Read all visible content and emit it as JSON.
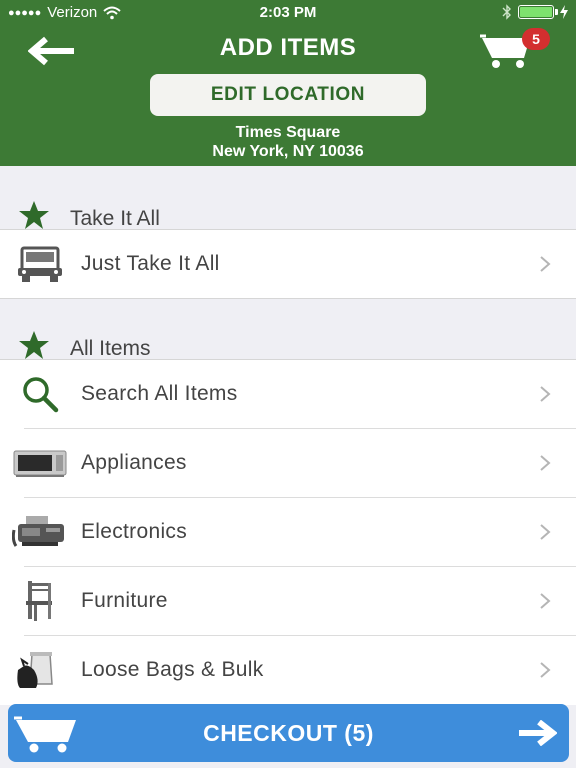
{
  "status_bar": {
    "carrier": "Verizon",
    "time": "2:03 PM"
  },
  "header": {
    "title": "ADD ITEMS",
    "cart_count": "5",
    "edit_location_label": "EDIT LOCATION",
    "location_line1": "Times Square",
    "location_line2": "New York, NY 10036"
  },
  "sections": {
    "take_it_all": {
      "title": "Take It All",
      "items": [
        {
          "label": "Just Take It All",
          "icon": "truck-icon"
        }
      ]
    },
    "all_items": {
      "title": "All Items",
      "items": [
        {
          "label": "Search All Items",
          "icon": "search-icon"
        },
        {
          "label": "Appliances",
          "icon": "microwave-icon"
        },
        {
          "label": "Electronics",
          "icon": "fax-machine-icon"
        },
        {
          "label": "Furniture",
          "icon": "chair-icon"
        },
        {
          "label": "Loose Bags & Bulk",
          "icon": "trash-bags-icon"
        }
      ]
    }
  },
  "checkout": {
    "label": "CHECKOUT (5)"
  },
  "colors": {
    "header_green": "#3d7a35",
    "badge_red": "#d32f2f",
    "checkout_blue": "#3e8ddb",
    "star_green": "#2f6a2a"
  }
}
